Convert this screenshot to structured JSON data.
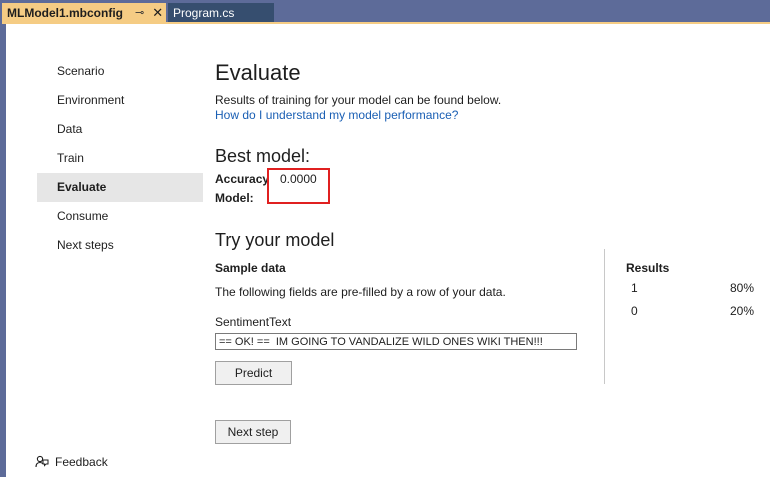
{
  "tabs": {
    "active": {
      "label": "MLModel1.mbconfig",
      "pin_icon": "pin-icon",
      "close_icon": "close-icon",
      "pin_glyph": "⊸",
      "close_glyph": "✕"
    },
    "inactive": {
      "label": "Program.cs"
    }
  },
  "nav": {
    "items": [
      {
        "label": "Scenario",
        "selected": false
      },
      {
        "label": "Environment",
        "selected": false
      },
      {
        "label": "Data",
        "selected": false
      },
      {
        "label": "Train",
        "selected": false
      },
      {
        "label": "Evaluate",
        "selected": true
      },
      {
        "label": "Consume",
        "selected": false
      },
      {
        "label": "Next steps",
        "selected": false
      }
    ],
    "feedback": {
      "label": "Feedback",
      "icon": "feedback-icon"
    }
  },
  "evaluate": {
    "title": "Evaluate",
    "subtitle": "Results of training for your model can be found below.",
    "link": "How do I understand my model performance?"
  },
  "best_model": {
    "title": "Best model:",
    "accuracy_label": "Accuracy",
    "accuracy_value": "0.0000",
    "model_label": "Model:",
    "highlight_color": "#e02020"
  },
  "try_model": {
    "title": "Try your model",
    "sample_title": "Sample data",
    "sample_desc": "The following fields are pre-filled by a row of your data.",
    "field_label": "SentimentText",
    "field_value": "== OK! ==  IM GOING TO VANDALIZE WILD ONES WIKI THEN!!!",
    "predict_label": "Predict",
    "next_step_label": "Next step"
  },
  "results": {
    "title": "Results",
    "rows": [
      {
        "label": "1",
        "value": "80%"
      },
      {
        "label": "0",
        "value": "20%"
      }
    ]
  },
  "colors": {
    "tab_active": "#f5cc84",
    "tab_inactive": "#364e6f",
    "chrome": "#5d6b99",
    "link": "#1a5fb4"
  }
}
